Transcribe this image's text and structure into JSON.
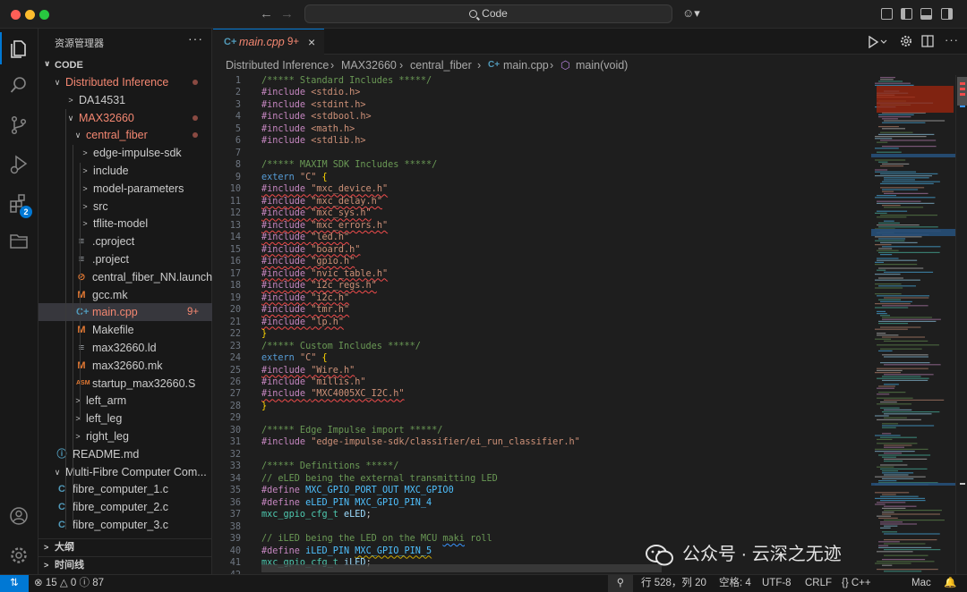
{
  "titlebar": {
    "search_label": "Code"
  },
  "sidebar": {
    "title": "资源管理器",
    "more": "···",
    "section": "CODE",
    "tree": [
      {
        "label": "Distributed Inference",
        "depth": 0,
        "kind": "folder-open",
        "color": "#f48771",
        "dot": true
      },
      {
        "label": "DA14531",
        "depth": 1,
        "kind": "folder",
        "color": "#cccccc"
      },
      {
        "label": "MAX32660",
        "depth": 1,
        "kind": "folder-open",
        "color": "#f48771",
        "dot": true
      },
      {
        "label": "central_fiber",
        "depth": 2,
        "kind": "folder-open",
        "color": "#f48771",
        "dot": true
      },
      {
        "label": "edge-impulse-sdk",
        "depth": 3,
        "kind": "folder",
        "color": "#cccccc"
      },
      {
        "label": "include",
        "depth": 3,
        "kind": "folder",
        "color": "#cccccc"
      },
      {
        "label": "model-parameters",
        "depth": 3,
        "kind": "folder",
        "color": "#cccccc"
      },
      {
        "label": "src",
        "depth": 3,
        "kind": "folder",
        "color": "#cccccc"
      },
      {
        "label": "tflite-model",
        "depth": 3,
        "kind": "folder",
        "color": "#cccccc"
      },
      {
        "label": ".cproject",
        "depth": 3,
        "kind": "file",
        "icon": "lines",
        "color": "#cccccc"
      },
      {
        "label": ".project",
        "depth": 3,
        "kind": "file",
        "icon": "lines",
        "color": "#cccccc"
      },
      {
        "label": "central_fiber_NN.launch",
        "depth": 3,
        "kind": "file",
        "icon": "rss",
        "color": "#cccccc"
      },
      {
        "label": "gcc.mk",
        "depth": 3,
        "kind": "file",
        "icon": "M",
        "color": "#cccccc"
      },
      {
        "label": "main.cpp",
        "depth": 3,
        "kind": "file",
        "icon": "cpp",
        "color": "#f48771",
        "problems": "9+",
        "selected": true
      },
      {
        "label": "Makefile",
        "depth": 3,
        "kind": "file",
        "icon": "M",
        "color": "#cccccc"
      },
      {
        "label": "max32660.ld",
        "depth": 3,
        "kind": "file",
        "icon": "lines",
        "color": "#cccccc"
      },
      {
        "label": "max32660.mk",
        "depth": 3,
        "kind": "file",
        "icon": "M",
        "color": "#cccccc"
      },
      {
        "label": "startup_max32660.S",
        "depth": 3,
        "kind": "file",
        "icon": "asm",
        "color": "#cccccc"
      },
      {
        "label": "left_arm",
        "depth": 2,
        "kind": "folder",
        "color": "#cccccc"
      },
      {
        "label": "left_leg",
        "depth": 2,
        "kind": "folder",
        "color": "#cccccc"
      },
      {
        "label": "right_leg",
        "depth": 2,
        "kind": "folder",
        "color": "#cccccc"
      },
      {
        "label": "README.md",
        "depth": 1,
        "kind": "file",
        "icon": "info",
        "color": "#cccccc"
      },
      {
        "label": "Multi-Fibre Computer Com...",
        "depth": 0,
        "kind": "folder-open",
        "color": "#cccccc"
      },
      {
        "label": "fibre_computer_1.c",
        "depth": 1,
        "kind": "file",
        "icon": "c",
        "color": "#cccccc"
      },
      {
        "label": "fibre_computer_2.c",
        "depth": 1,
        "kind": "file",
        "icon": "c",
        "color": "#cccccc"
      },
      {
        "label": "fibre_computer_3.c",
        "depth": 1,
        "kind": "file",
        "icon": "c",
        "color": "#cccccc"
      }
    ],
    "outline": "大纲",
    "timeline": "时间线"
  },
  "activity": {
    "extensions_badge": "2"
  },
  "tab": {
    "label": "main.cpp",
    "problems": "9+",
    "close": "×"
  },
  "breadcrumb": [
    "Distributed Inference",
    "MAX32660",
    "central_fiber",
    "main.cpp",
    "main(void)"
  ],
  "code": [
    {
      "n": "1",
      "text": "/***** Standard Includes *****/",
      "type": "comment"
    },
    {
      "n": "2",
      "text": "#include <stdio.h>",
      "type": "include"
    },
    {
      "n": "3",
      "text": "#include <stdint.h>",
      "type": "include"
    },
    {
      "n": "4",
      "text": "#include <stdbool.h>",
      "type": "include"
    },
    {
      "n": "5",
      "text": "#include <math.h>",
      "type": "include"
    },
    {
      "n": "6",
      "text": "#include <stdlib.h>",
      "type": "include"
    },
    {
      "n": "7",
      "text": "",
      "type": "plain"
    },
    {
      "n": "8",
      "text": "/***** MAXIM SDK Includes *****/",
      "type": "comment"
    },
    {
      "n": "9",
      "text": "extern \"C\" {",
      "type": "extern"
    },
    {
      "n": "10",
      "text": "#include \"mxc_device.h\"",
      "type": "include-err"
    },
    {
      "n": "11",
      "text": "#include \"mxc_delay.h\"",
      "type": "include-err"
    },
    {
      "n": "12",
      "text": "#include \"mxc_sys.h\"",
      "type": "include-err"
    },
    {
      "n": "13",
      "text": "#include \"mxc_errors.h\"",
      "type": "include-err"
    },
    {
      "n": "14",
      "text": "#include \"led.h\"",
      "type": "include-err"
    },
    {
      "n": "15",
      "text": "#include \"board.h\"",
      "type": "include-err"
    },
    {
      "n": "16",
      "text": "#include \"gpio.h\"",
      "type": "include-err"
    },
    {
      "n": "17",
      "text": "#include \"nvic_table.h\"",
      "type": "include-err"
    },
    {
      "n": "18",
      "text": "#include \"i2c_regs.h\"",
      "type": "include-err"
    },
    {
      "n": "19",
      "text": "#include \"i2c.h\"",
      "type": "include-err"
    },
    {
      "n": "20",
      "text": "#include \"tmr.h\"",
      "type": "include-err"
    },
    {
      "n": "21",
      "text": "#include \"lp.h\"",
      "type": "include-err"
    },
    {
      "n": "22",
      "text": "}",
      "type": "brace"
    },
    {
      "n": "23",
      "text": "/***** Custom Includes *****/",
      "type": "comment"
    },
    {
      "n": "24",
      "text": "extern \"C\" {",
      "type": "extern"
    },
    {
      "n": "25",
      "text": "#include \"Wire.h\"",
      "type": "include-err"
    },
    {
      "n": "26",
      "text": "#include \"millis.h\"",
      "type": "include"
    },
    {
      "n": "27",
      "text": "#include \"MXC4005XC_I2C.h\"",
      "type": "include-err"
    },
    {
      "n": "28",
      "text": "}",
      "type": "brace"
    },
    {
      "n": "29",
      "text": "",
      "type": "plain"
    },
    {
      "n": "30",
      "text": "/***** Edge Impulse import *****/",
      "type": "comment"
    },
    {
      "n": "31",
      "text": "#include \"edge-impulse-sdk/classifier/ei_run_classifier.h\"",
      "type": "include"
    },
    {
      "n": "32",
      "text": "",
      "type": "plain"
    },
    {
      "n": "33",
      "text": "/***** Definitions *****/",
      "type": "comment"
    },
    {
      "n": "34",
      "text": "// eLED being the external transmitting LED",
      "type": "comment"
    },
    {
      "n": "35",
      "text": "#define MXC_GPIO_PORT_OUT MXC_GPIO0",
      "type": "define"
    },
    {
      "n": "36",
      "text": "#define eLED_PIN MXC_GPIO_PIN_4",
      "type": "define"
    },
    {
      "n": "37",
      "text": "mxc_gpio_cfg_t eLED;",
      "type": "decl"
    },
    {
      "n": "38",
      "text": "",
      "type": "plain"
    },
    {
      "n": "39",
      "text": "// iLED being the LED on the MCU maki roll",
      "type": "comment"
    },
    {
      "n": "40",
      "text": "#define iLED_PIN MXC_GPIO_PIN_5",
      "type": "define"
    },
    {
      "n": "41",
      "text": "mxc_gpio_cfg_t iLED;",
      "type": "decl"
    },
    {
      "n": "42",
      "text": "",
      "type": "plain"
    }
  ],
  "watermark": "公众号 · 云深之无迹",
  "status": {
    "errors": "15",
    "warnings": "0",
    "info": "87",
    "position": "行 528，列 20",
    "spaces": "空格: 4",
    "encoding": "UTF-8",
    "eol": "CRLF",
    "language": "C++",
    "platform": "Mac"
  },
  "colors": {
    "accent": "#0078d4",
    "comment": "#6a9955",
    "keyword": "#569cd6",
    "string": "#ce9178",
    "preprocessor": "#c586c0",
    "macro": "#4fc1ff",
    "type": "#4ec9b0",
    "variable": "#9cdcfe",
    "brace": "#ffd700"
  }
}
